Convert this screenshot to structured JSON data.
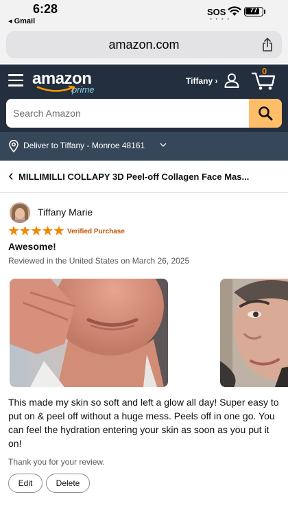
{
  "status": {
    "time": "6:28",
    "back_app": "◂ Gmail",
    "sos": "SOS",
    "battery": "77"
  },
  "browser": {
    "url": "amazon.com"
  },
  "header": {
    "logo_text": "amazon",
    "logo_prime": "prime",
    "user_label": "Tiffany ›",
    "cart_count": "0",
    "search_placeholder": "Search Amazon"
  },
  "deliver": {
    "text": "Deliver to Tiffany - Monroe 48161"
  },
  "product": {
    "title": "MILLIMILLI COLLAPY 3D Peel-off Collagen Face Mas..."
  },
  "review": {
    "reviewer": "Tiffany Marie",
    "rating": 5,
    "verified": "Verified Purchase",
    "headline": "Awesome!",
    "reviewed_line": "Reviewed in the United States on March 26, 2025",
    "body": "This made my skin so soft and left a glow all day! Super easy to put on & peel off without a huge mess. Peels off in one go. You can feel the hydration entering your skin as soon as you put it on!",
    "thanks": "Thank you for your review.",
    "edit_label": "Edit",
    "delete_label": "Delete"
  },
  "colors": {
    "header_bg": "#232f3e",
    "deliver_bg": "#37475a",
    "search_btn": "#febd69",
    "star": "#f08804",
    "verified": "#c45500",
    "cart_count": "#f08804"
  }
}
